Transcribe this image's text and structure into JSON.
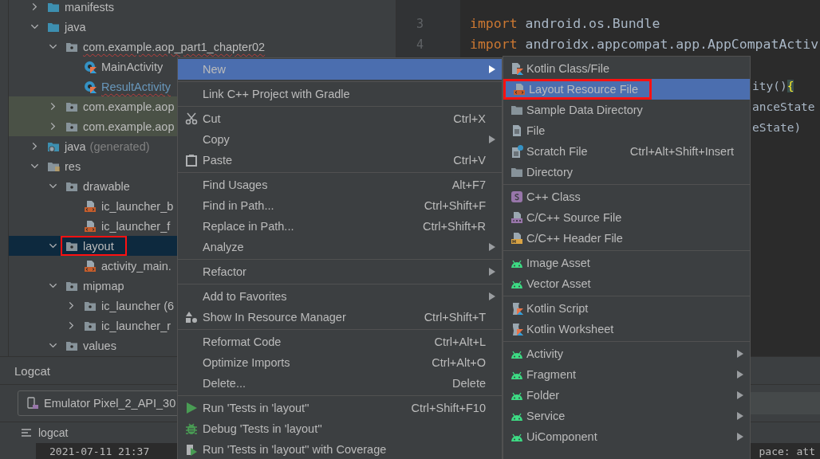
{
  "tree": [
    {
      "label": "manifests",
      "kind": "sourceroot",
      "expanded": false,
      "selected": false
    },
    {
      "label": "java",
      "kind": "sourceroot",
      "expanded": true,
      "selected": false,
      "children": [
        {
          "label": "com.example.aop_part1_chapter02",
          "kind": "package",
          "expanded": true,
          "selected": false,
          "error": true,
          "children": [
            {
              "label": "MainActivity",
              "kind": "kotlin",
              "selected": false
            },
            {
              "label": "ResultActivity",
              "kind": "kotlin",
              "selected": false,
              "added": true,
              "error": true
            }
          ]
        },
        {
          "label": "com.example.aop",
          "kind": "package",
          "expanded": false,
          "selected": false,
          "tinted": true
        },
        {
          "label": "com.example.aop",
          "kind": "package",
          "expanded": false,
          "selected": false,
          "tinted": true
        }
      ]
    },
    {
      "label": "java",
      "note": "(generated)",
      "kind": "generated",
      "expanded": false,
      "selected": false
    },
    {
      "label": "res",
      "kind": "resources",
      "expanded": true,
      "selected": false,
      "children": [
        {
          "label": "drawable",
          "kind": "package",
          "expanded": true,
          "selected": false,
          "children": [
            {
              "label": "ic_launcher_b",
              "kind": "xml",
              "selected": false
            },
            {
              "label": "ic_launcher_f",
              "kind": "xml",
              "selected": false
            }
          ]
        },
        {
          "label": "layout",
          "kind": "package",
          "expanded": true,
          "selected": true,
          "highlighted": true,
          "children": [
            {
              "label": "activity_main.",
              "kind": "xml",
              "selected": false
            }
          ]
        },
        {
          "label": "mipmap",
          "kind": "package",
          "expanded": true,
          "selected": false,
          "children": [
            {
              "label": "ic_launcher (6",
              "kind": "package",
              "expanded": false,
              "selected": false
            },
            {
              "label": "ic_launcher_r",
              "kind": "package",
              "expanded": false,
              "selected": false
            }
          ]
        },
        {
          "label": "values",
          "kind": "package",
          "expanded": true,
          "selected": false
        }
      ]
    }
  ],
  "editor": {
    "lines": [
      {
        "kind": "line",
        "number": "3",
        "code": [
          {
            "kind": "keyword",
            "text": "import"
          },
          {
            "kind": "plain",
            "text": " android.os.Bundle"
          }
        ]
      },
      {
        "kind": "line",
        "number": "4",
        "code": [
          {
            "kind": "keyword",
            "text": "import"
          },
          {
            "kind": "plain",
            "text": " androidx.appcompat.app.AppCompatActiv"
          }
        ]
      },
      {
        "kind": "fragment",
        "code": [
          {
            "kind": "plain",
            "text": "ity()"
          },
          {
            "kind": "brace-match",
            "text": "{"
          }
        ]
      },
      {
        "kind": "fragment",
        "code": [
          {
            "kind": "plain",
            "text": "anceState"
          }
        ]
      },
      {
        "kind": "fragment",
        "code": [
          {
            "kind": "plain",
            "text": "eState)"
          }
        ]
      }
    ]
  },
  "logcat": {
    "title": "Logcat",
    "device": "Emulator Pixel_2_API_30",
    "tab": "logcat",
    "log_start": "2021-07-11 21:37",
    "log_end": "pace: att"
  },
  "context_menu": [
    {
      "kind": "plain",
      "label": "New",
      "submenu": true,
      "selected": true
    },
    {
      "kind": "separator"
    },
    {
      "kind": "plain",
      "label": "Link C++ Project with Gradle",
      "selected": false
    },
    {
      "kind": "separator"
    },
    {
      "kind": "cut",
      "label": "Cut",
      "shortcut": "Ctrl+X",
      "selected": false
    },
    {
      "kind": "plain",
      "label": "Copy",
      "submenu": true,
      "selected": false
    },
    {
      "kind": "paste",
      "label": "Paste",
      "shortcut": "Ctrl+V",
      "selected": false
    },
    {
      "kind": "separator"
    },
    {
      "kind": "plain",
      "label": "Find Usages",
      "shortcut": "Alt+F7",
      "selected": false
    },
    {
      "kind": "plain",
      "label": "Find in Path...",
      "shortcut": "Ctrl+Shift+F",
      "selected": false
    },
    {
      "kind": "plain",
      "label": "Replace in Path...",
      "shortcut": "Ctrl+Shift+R",
      "selected": false
    },
    {
      "kind": "plain",
      "label": "Analyze",
      "submenu": true,
      "selected": false
    },
    {
      "kind": "separator"
    },
    {
      "kind": "plain",
      "label": "Refactor",
      "submenu": true,
      "selected": false
    },
    {
      "kind": "separator"
    },
    {
      "kind": "plain",
      "label": "Add to Favorites",
      "submenu": true,
      "selected": false
    },
    {
      "kind": "resource",
      "label": "Show In Resource Manager",
      "shortcut": "Ctrl+Shift+T",
      "selected": false
    },
    {
      "kind": "separator"
    },
    {
      "kind": "plain",
      "label": "Reformat Code",
      "shortcut": "Ctrl+Alt+L",
      "selected": false
    },
    {
      "kind": "plain",
      "label": "Optimize Imports",
      "shortcut": "Ctrl+Alt+O",
      "selected": false
    },
    {
      "kind": "plain",
      "label": "Delete...",
      "shortcut": "Delete",
      "selected": false
    },
    {
      "kind": "separator"
    },
    {
      "kind": "run",
      "label": "Run 'Tests in 'layout''",
      "shortcut": "Ctrl+Shift+F10",
      "selected": false
    },
    {
      "kind": "debug",
      "label": "Debug 'Tests in 'layout''",
      "selected": false
    },
    {
      "kind": "coverage",
      "label": "Run 'Tests in 'layout'' with Coverage",
      "selected": false
    }
  ],
  "new_submenu": [
    {
      "kind": "kotlinfile",
      "label": "Kotlin Class/File",
      "selected": false
    },
    {
      "kind": "layout",
      "label": "Layout Resource File",
      "selected": true,
      "highlighted": true
    },
    {
      "kind": "folder",
      "label": "Sample Data Directory",
      "selected": false
    },
    {
      "kind": "file",
      "label": "File",
      "selected": false
    },
    {
      "kind": "scratch",
      "label": "Scratch File",
      "shortcut": "Ctrl+Alt+Shift+Insert",
      "selected": false
    },
    {
      "kind": "folder",
      "label": "Directory",
      "selected": false
    },
    {
      "kind": "separator"
    },
    {
      "kind": "cppclass",
      "label": "C++ Class",
      "selected": false
    },
    {
      "kind": "cppsource",
      "label": "C/C++ Source File",
      "selected": false
    },
    {
      "kind": "cppheader",
      "label": "C/C++ Header File",
      "selected": false
    },
    {
      "kind": "separator"
    },
    {
      "kind": "android",
      "label": "Image Asset",
      "selected": false
    },
    {
      "kind": "android",
      "label": "Vector Asset",
      "selected": false
    },
    {
      "kind": "separator"
    },
    {
      "kind": "script",
      "label": "Kotlin Script",
      "selected": false
    },
    {
      "kind": "script",
      "label": "Kotlin Worksheet",
      "selected": false
    },
    {
      "kind": "separator"
    },
    {
      "kind": "android",
      "label": "Activity",
      "submenu": true,
      "selected": false
    },
    {
      "kind": "android",
      "label": "Fragment",
      "submenu": true,
      "selected": false
    },
    {
      "kind": "android",
      "label": "Folder",
      "submenu": true,
      "selected": false
    },
    {
      "kind": "android",
      "label": "Service",
      "submenu": true,
      "selected": false
    },
    {
      "kind": "android",
      "label": "UiComponent",
      "submenu": true,
      "selected": false
    }
  ]
}
